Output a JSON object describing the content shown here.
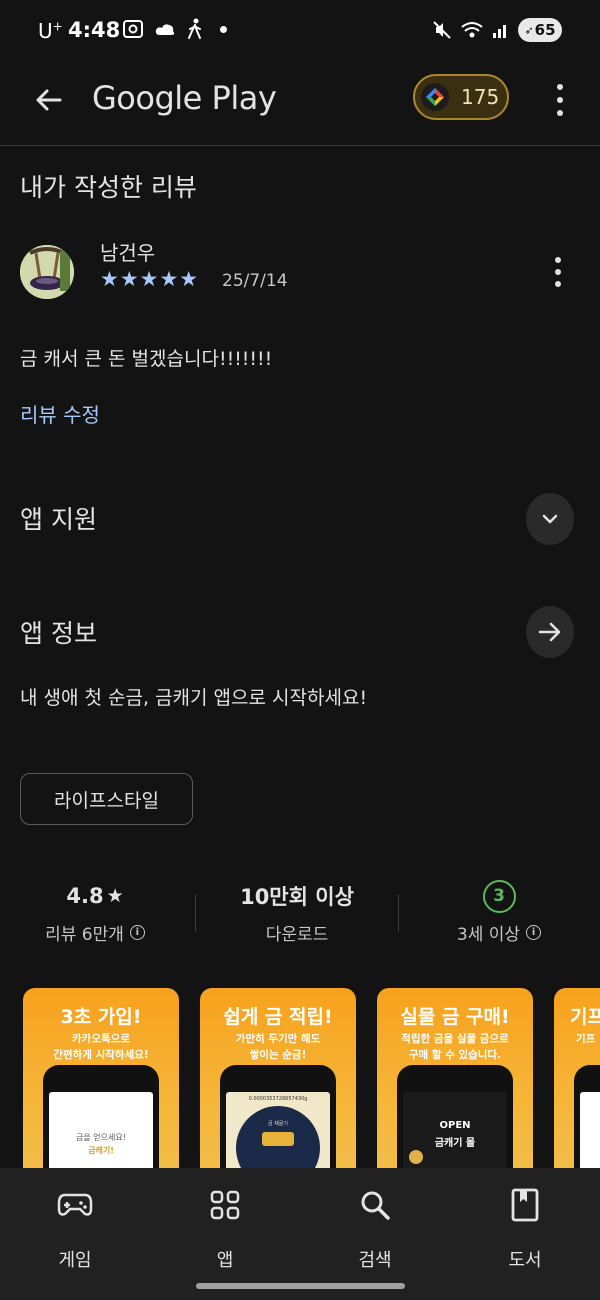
{
  "status_bar": {
    "carrier": "U",
    "carrier_sup": "+",
    "time": "4:48",
    "battery": "65"
  },
  "app_bar": {
    "title": "Google Play",
    "points": "175"
  },
  "review": {
    "section_title": "내가 작성한 리뷰",
    "reviewer": "남건우",
    "stars": "★★★★★",
    "rating": 5,
    "date": "25/7/14",
    "text": "금 캐서 큰 돈 벌겠습니다!!!!!!!",
    "edit_label": "리뷰 수정"
  },
  "support": {
    "title": "앱 지원"
  },
  "info": {
    "title": "앱 정보",
    "description": "내 생애 첫 순금, 금캐기 앱으로 시작하세요!",
    "category": "라이프스타일"
  },
  "stats": {
    "rating": "4.8",
    "rating_star": "★",
    "reviews": "리뷰 6만개",
    "downloads": "10만회 이상",
    "downloads_label": "다운로드",
    "age": "3",
    "age_label": "3세 이상"
  },
  "screenshots": [
    {
      "title": "3초 가입!",
      "sub1": "카카오톡으로",
      "sub2": "간편하게 시작하세요!",
      "screen1": "금을 얻으세요!",
      "screen2": "금캐기!"
    },
    {
      "title": "쉽게 금 적립!",
      "sub1": "가만히 두기만 해도",
      "sub2": "쌓이는 순금!",
      "screen1": "0.0000353728657430g",
      "screen2": "금 채굴기"
    },
    {
      "title": "실물 금 구매!",
      "sub1": "적립한 금을 실물 금으로",
      "sub2": "구매 할 수 있습니다.",
      "screen1": "OPEN",
      "screen2": "금캐기 몰"
    },
    {
      "title": "기프",
      "sub1": "기프",
      "sub2": ""
    }
  ],
  "bottom_nav": [
    {
      "label": "게임",
      "icon": "gamepad-icon"
    },
    {
      "label": "앱",
      "icon": "apps-grid-icon"
    },
    {
      "label": "검색",
      "icon": "search-icon"
    },
    {
      "label": "도서",
      "icon": "book-icon"
    }
  ],
  "colors": {
    "accent": "#a8c7fa",
    "age_badge": "#5bb85e",
    "points_border": "#a8862c",
    "background": "#131313"
  }
}
